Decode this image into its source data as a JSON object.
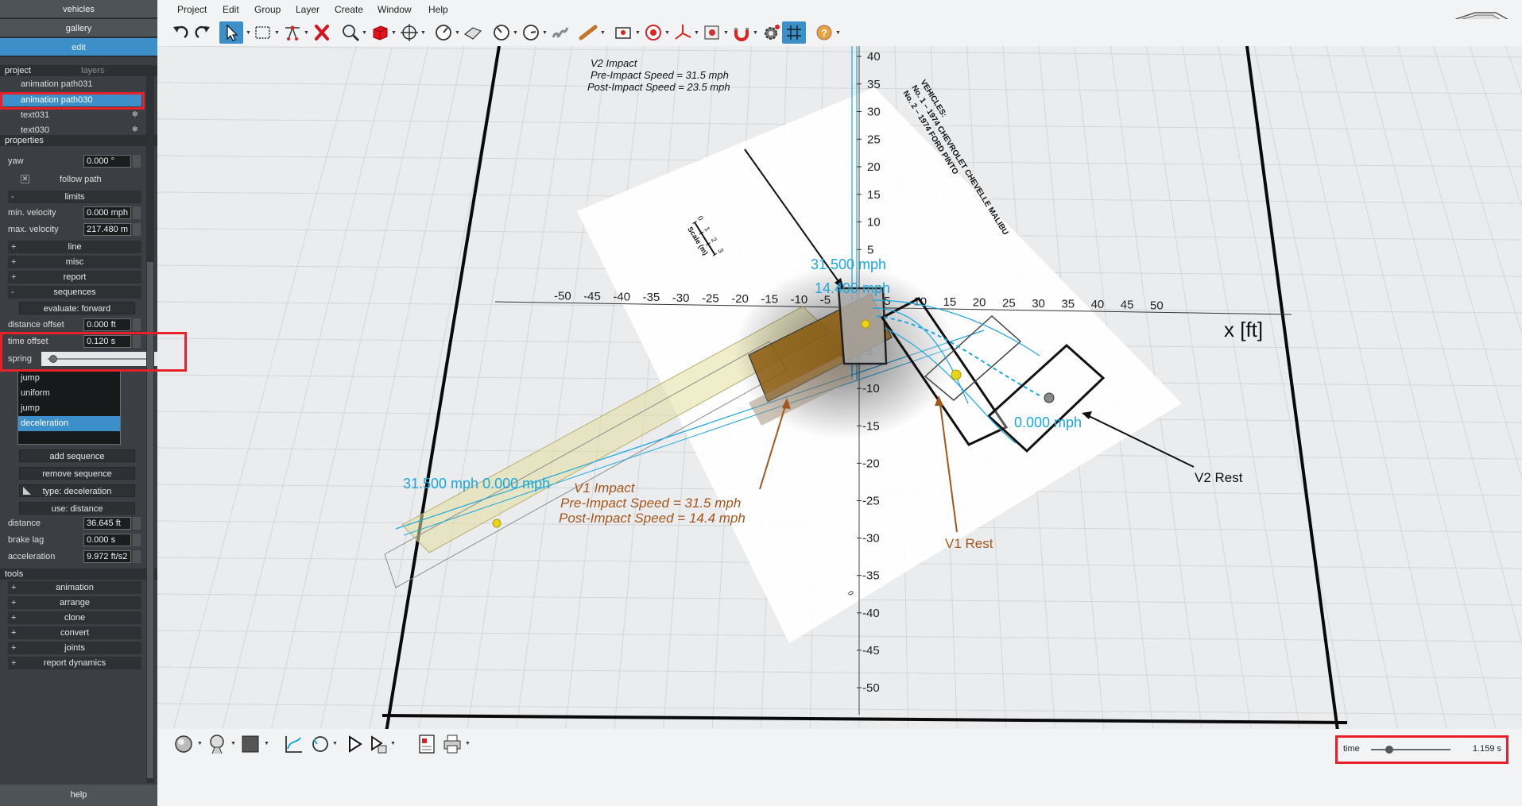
{
  "left_panel": {
    "tabs": [
      "vehicles",
      "gallery",
      "edit"
    ],
    "project_header": "project",
    "layers_header": "layers",
    "tree": [
      "animation path031",
      "animation path030",
      "text031",
      "text030"
    ],
    "properties_header": "properties",
    "yaw": {
      "label": "yaw",
      "value": "0.000 °"
    },
    "follow_path": "follow path",
    "limits": "limits",
    "min_velocity": {
      "label": "min. velocity",
      "value": "0.000 mph"
    },
    "max_velocity": {
      "label": "max. velocity",
      "value": "217.480 m"
    },
    "line": "line",
    "misc": "misc",
    "report": "report",
    "sequences": "sequences",
    "evaluate": "evaluate: forward",
    "distance_offset": {
      "label": "distance offset",
      "value": "0.000 ft"
    },
    "time_offset": {
      "label": "time offset",
      "value": "0.120 s"
    },
    "spring": "spring",
    "sequence_list": [
      "jump",
      "uniform",
      "jump",
      "deceleration"
    ],
    "add_sequence": "add sequence",
    "remove_sequence": "remove sequence",
    "type": "type: deceleration",
    "use": "use: distance",
    "distance": {
      "label": "distance",
      "value": "36.645 ft"
    },
    "brake_lag": {
      "label": "brake lag",
      "value": "0.000 s"
    },
    "acceleration": {
      "label": "acceleration",
      "value": "9.972 ft/s2"
    },
    "tools_header": "tools",
    "tools": [
      "animation",
      "arrange",
      "clone",
      "convert",
      "joints",
      "report dynamics"
    ],
    "help": "help",
    "plus": "+",
    "minus": "-"
  },
  "menu": [
    "Project",
    "Edit",
    "Group",
    "Layer",
    "Create",
    "Window",
    "Help"
  ],
  "toolbar_icons": [
    "undo-icon",
    "redo-icon",
    "select-arrow-icon",
    "selection-rect-icon",
    "node-edit-icon",
    "delete-icon",
    "zoom-icon",
    "box-3d-icon",
    "pan-icon",
    "measure-gauge-icon",
    "surface-icon",
    "gauge-2-icon",
    "gauge-3-icon",
    "spring-icon",
    "tape-icon",
    "camera-icon",
    "target-icon",
    "axes-icon",
    "photo-icon",
    "magnet-icon",
    "settings-icon",
    "grid-icon",
    "help-icon"
  ],
  "scene": {
    "x_ticks": [
      "-50",
      "-45",
      "-40",
      "-35",
      "-30",
      "-25",
      "-20",
      "-15",
      "-10",
      "-5",
      "5",
      "10",
      "15",
      "20",
      "25",
      "30",
      "35",
      "40",
      "45",
      "50"
    ],
    "y_ticks": [
      "40",
      "35",
      "30",
      "25",
      "20",
      "15",
      "10",
      "5",
      "-5",
      "-10",
      "-15",
      "-20",
      "-25",
      "-30",
      "-35",
      "-40",
      "-45",
      "-50"
    ],
    "x_axis_label": "x [ft]",
    "v2_impact": [
      "V2 Impact",
      "Pre-Impact Speed = 31.5 mph",
      "Post-Impact Speed = 23.5 mph"
    ],
    "v1_impact": [
      "V1 Impact",
      "Pre-Impact Speed = 31.5 mph",
      "Post-Impact Speed = 14.4 mph"
    ],
    "v2_rest": "V2 Rest",
    "v1_rest": "V1 Rest",
    "speed_labels": [
      "31.500 mph",
      "14.400 mph",
      "0.000 mph",
      "31.500 mph 0.000 mph"
    ],
    "diagram_header": [
      "VEHICLES:",
      "No. 1 – 1974 CHEVROLET CHEVELLE MALIBU",
      "No. 2 – 1974 FORD PINTO"
    ],
    "scale_label": "Scale (m)",
    "scale_ticks": [
      "0",
      "1",
      "2",
      "3"
    ],
    "origin_mark": "0",
    "colors": {
      "speed": "#1aa7e0",
      "v1": "#a5561a",
      "vehicle_body": "#8b5a0d",
      "highlight": "#e8202a"
    }
  },
  "bottom": {
    "time_label": "time",
    "time_value": "1.159 s",
    "time_fraction": 0.2
  }
}
